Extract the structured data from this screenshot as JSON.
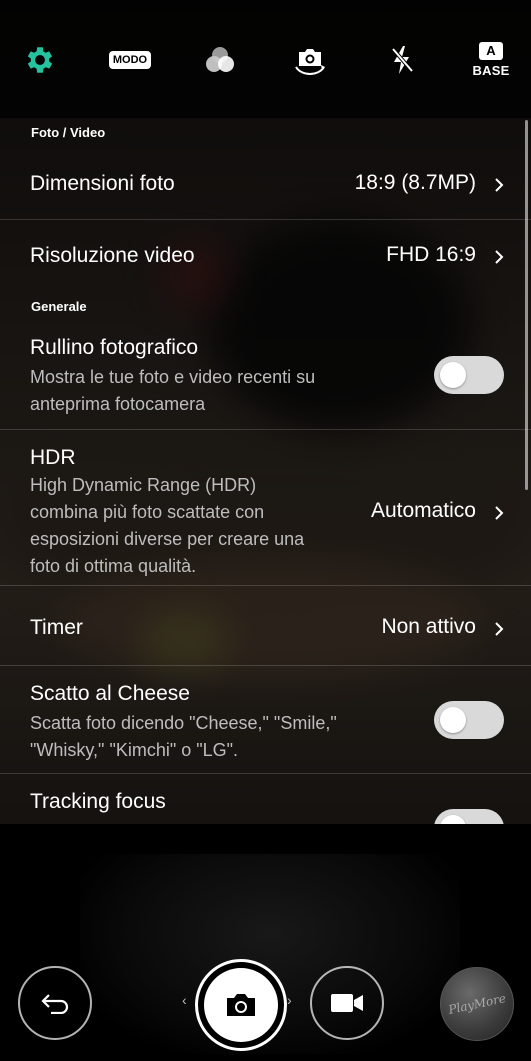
{
  "toolbar": {
    "items": [
      {
        "icon": "gear-icon",
        "color": "#25c2a0"
      },
      {
        "icon": "modo-icon",
        "label": "MODO"
      },
      {
        "icon": "filter-icon"
      },
      {
        "icon": "switch-camera-icon"
      },
      {
        "icon": "flash-off-icon"
      },
      {
        "icon": "base-mode-icon",
        "badge": "A",
        "label": "BASE"
      }
    ]
  },
  "settings": {
    "sections": {
      "photo_video": "Foto / Video",
      "general": "Generale"
    },
    "photo_size": {
      "title": "Dimensioni foto",
      "value": "18:9 (8.7MP)"
    },
    "video_resolution": {
      "title": "Risoluzione video",
      "value": "FHD 16:9"
    },
    "camera_roll": {
      "title": "Rullino fotografico",
      "description": "Mostra le tue foto e video recenti su anteprima fotocamera",
      "enabled": false
    },
    "hdr": {
      "title": "HDR",
      "description": "High Dynamic Range (HDR) combina più foto scattate con esposizioni diverse per creare una foto di ottima qualità.",
      "value": "Automatico"
    },
    "timer": {
      "title": "Timer",
      "value": "Non attivo"
    },
    "cheese_shutter": {
      "title": "Scatto al Cheese",
      "description": "Scatta foto dicendo \"Cheese,\" \"Smile,\" \"Whisky,\" \"Kimchi\" o \"LG\".",
      "enabled": false
    },
    "tracking_focus": {
      "title": "Tracking focus",
      "enabled": false
    }
  },
  "bottom_bar": {
    "back": "back-icon",
    "shutter": "camera-icon",
    "video": "video-camera-icon",
    "gallery_text": "PlayMore"
  }
}
